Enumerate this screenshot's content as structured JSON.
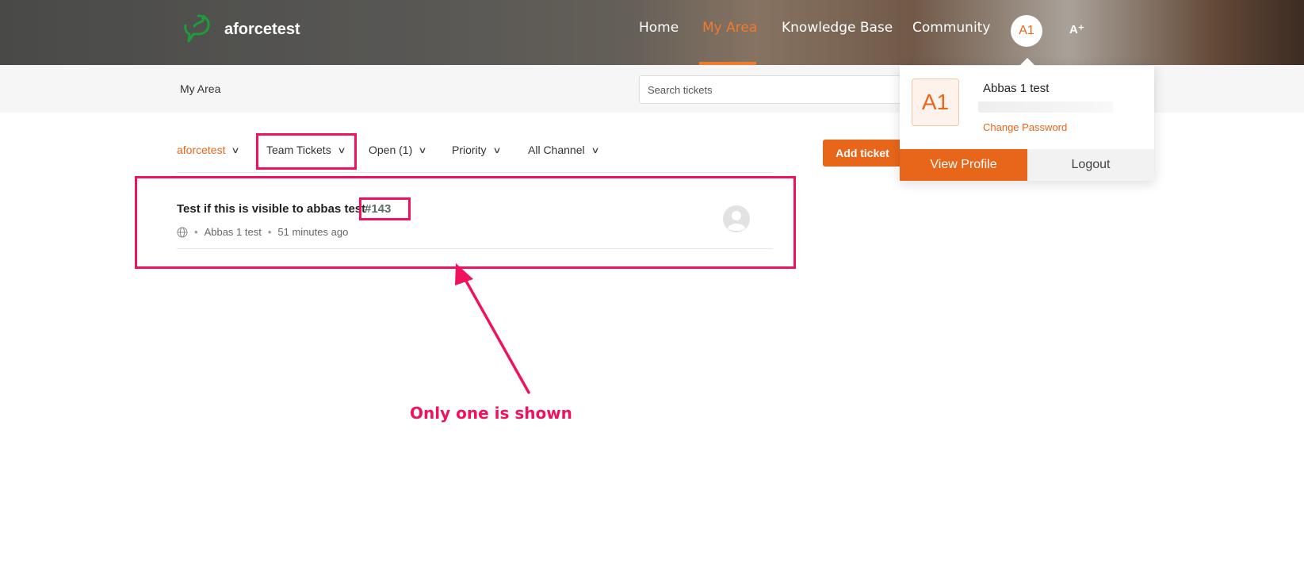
{
  "header": {
    "brand": "aforcetest",
    "nav": [
      {
        "label": "Home",
        "active": false
      },
      {
        "label": "My Area",
        "active": true
      },
      {
        "label": "Knowledge Base",
        "active": false
      },
      {
        "label": "Community",
        "active": false
      }
    ],
    "avatar_initials": "A1",
    "font_size_icon": "A⁺",
    "accent_color": "#e8661a",
    "logo_icon": "chat-bubble-logo-icon"
  },
  "subbar": {
    "breadcrumb": "My Area",
    "search_placeholder": "Search tickets"
  },
  "filters": {
    "organization": "aforcetest",
    "ticket_scope": "Team Tickets",
    "status": "Open (1)",
    "priority": "Priority",
    "channel": "All Channel",
    "chevron_icon": "chevron-down-icon",
    "add_ticket": "Add ticket"
  },
  "tickets": [
    {
      "title": "Test if this is visible to abbas test",
      "id": "#143",
      "channel_icon": "globe-icon",
      "author": "Abbas 1 test",
      "time": "51 minutes ago",
      "assignee_icon": "default-avatar-icon"
    }
  ],
  "profile_popup": {
    "initials": "A1",
    "name": "Abbas 1 test",
    "change_password": "Change Password",
    "view_profile": "View Profile",
    "logout": "Logout"
  },
  "annotation": {
    "note": "Only one is shown",
    "color": "#f0125f"
  }
}
